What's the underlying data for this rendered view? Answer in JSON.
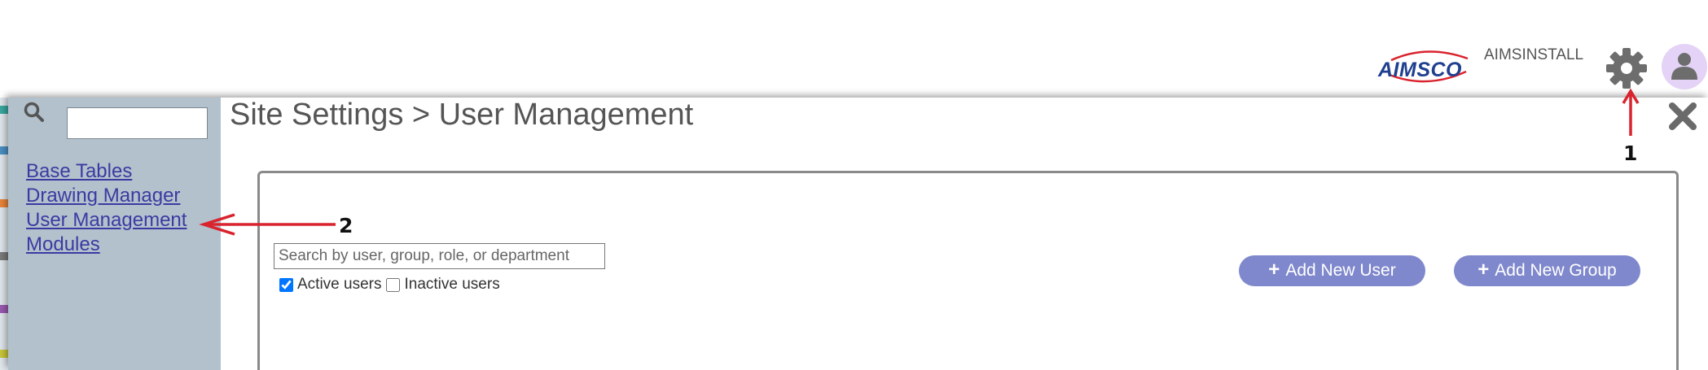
{
  "header": {
    "logo_text": "AIMSCO",
    "account_name": "AIMSINSTALL",
    "brand_color": "#1f3f8f"
  },
  "sidebar": {
    "search_value": "",
    "items": [
      {
        "label": "Base Tables"
      },
      {
        "label": "Drawing Manager"
      },
      {
        "label": "User Management"
      },
      {
        "label": "Modules"
      }
    ]
  },
  "dialog": {
    "title": "Site Settings > User Management"
  },
  "user_management": {
    "search_placeholder": "Search by user, group, role, or department",
    "active_users_label": "Active users",
    "active_users_checked": true,
    "inactive_users_label": "Inactive users",
    "inactive_users_checked": false,
    "add_user_label": "Add New User",
    "add_group_label": "Add New Group",
    "button_color": "#7f88cc"
  },
  "annotations": {
    "step1": "1",
    "step2": "2",
    "arrow_color": "#d9232e"
  },
  "icons": [
    "search-icon",
    "gear-icon",
    "user-avatar-icon",
    "close-icon",
    "plus-icon"
  ]
}
